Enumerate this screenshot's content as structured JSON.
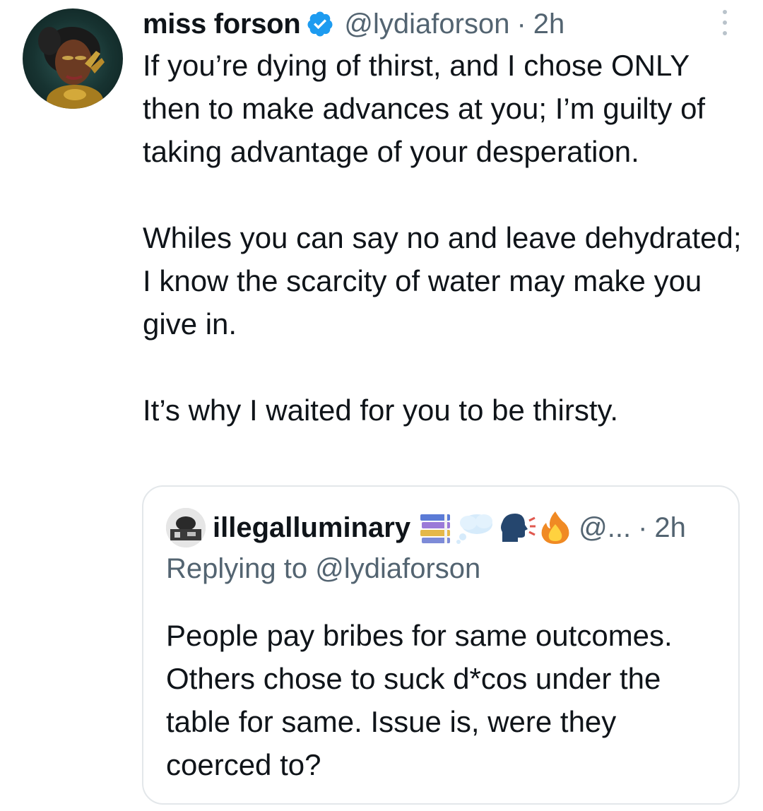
{
  "tweet": {
    "display_name": "miss forson",
    "handle": "@lydiaforson",
    "separator": "·",
    "time": "2h",
    "paragraphs": [
      "If you’re dying of thirst, and I chose ONLY then to make advances at you; I’m guilty of taking advantage of your desperation.",
      "Whiles you can say no and leave dehydrated; I know the scarcity of water may make you give in.",
      "It’s why I waited for you to be thirsty."
    ],
    "verified": true,
    "icons": {
      "verified": "verified-badge-icon",
      "more": "more-vertical-icon"
    }
  },
  "quoted_tweet": {
    "display_name": "illegalluminary",
    "name_emojis": [
      "books-icon",
      "thought-balloon-icon",
      "speaking-head-icon",
      "fire-icon"
    ],
    "handle": "@...",
    "separator": "·",
    "time": "2h",
    "replying_to": "Replying to @lydiaforson",
    "text": "People pay bribes for same outcomes. Others chose to suck d*cos under the table for same. Issue is, were they coerced to?"
  },
  "colors": {
    "text_primary": "#0f1419",
    "text_secondary": "#536471",
    "verified_blue": "#1d9bf0",
    "border": "#e3e7ea"
  }
}
